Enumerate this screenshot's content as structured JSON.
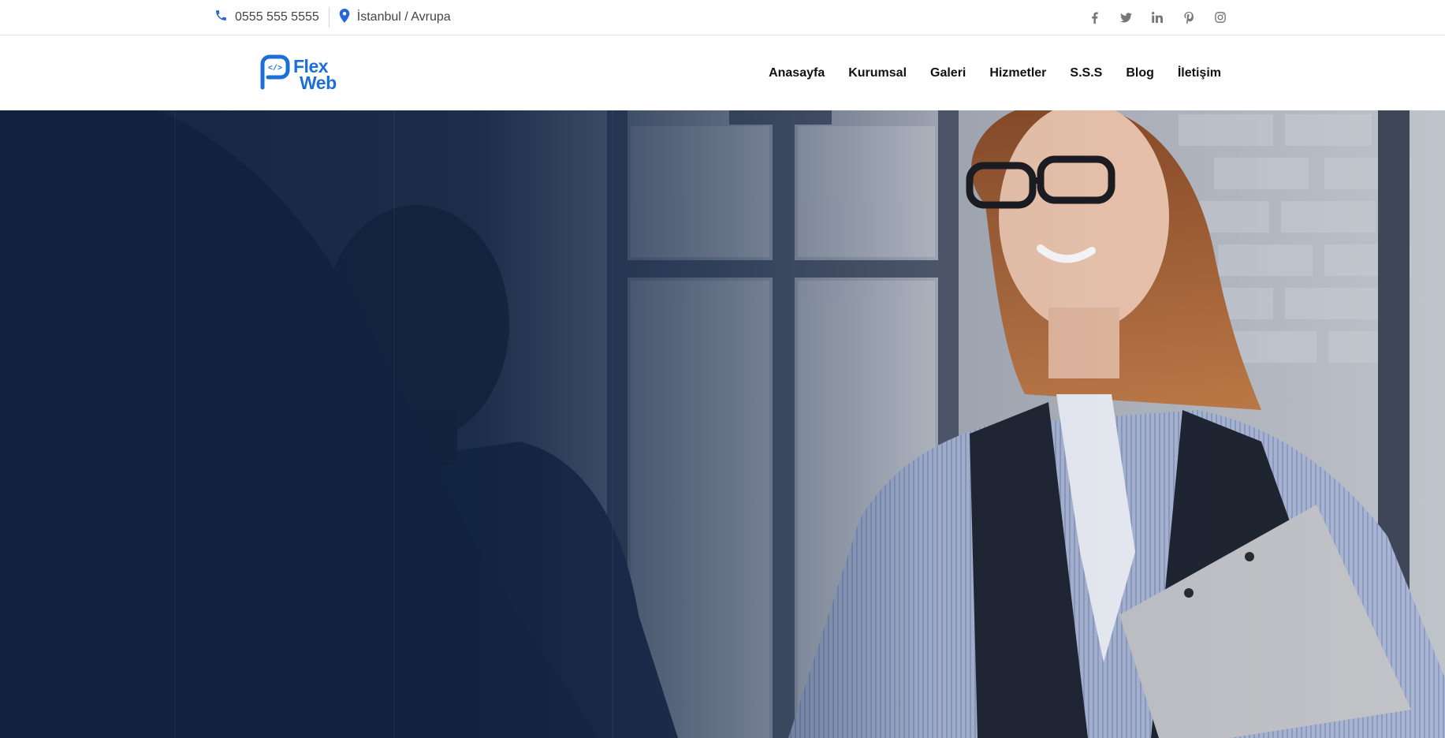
{
  "topbar": {
    "phone": "0555 555 5555",
    "location": "İstanbul / Avrupa",
    "social": [
      "facebook-icon",
      "twitter-icon",
      "linkedin-icon",
      "pinterest-icon",
      "instagram-icon"
    ]
  },
  "logo": {
    "line1": "Flex",
    "line2": "Web",
    "color": "#1d6fd8"
  },
  "nav": {
    "items": [
      "Anasayfa",
      "Kurumsal",
      "Galeri",
      "Hizmetler",
      "S.S.S",
      "Blog",
      "İletişim"
    ]
  },
  "hero": {
    "overlay_color": "#0f2240",
    "accent": "#2a66d6"
  }
}
